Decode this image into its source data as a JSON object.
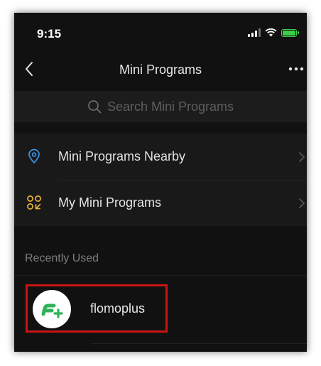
{
  "status_bar": {
    "time": "9:15"
  },
  "nav": {
    "title": "Mini Programs",
    "back_icon": "chevron-left-icon",
    "more_icon": "more-dots-icon"
  },
  "search": {
    "placeholder": "Search Mini Programs",
    "icon": "search-icon"
  },
  "menu": {
    "items": [
      {
        "label": "Mini Programs Nearby",
        "icon": "location-pin-icon",
        "color": "#3d8fe0"
      },
      {
        "label": "My Mini Programs",
        "icon": "mini-programs-icon",
        "color": "#e8b13a"
      }
    ]
  },
  "recent": {
    "section_title": "Recently Used",
    "items": [
      {
        "name": "flomoplus",
        "icon": "flomoplus-logo-icon",
        "color": "#30b35a"
      }
    ]
  },
  "colors": {
    "background": "#111111",
    "highlight": "#c81414",
    "battery": "#3ecf4a"
  }
}
